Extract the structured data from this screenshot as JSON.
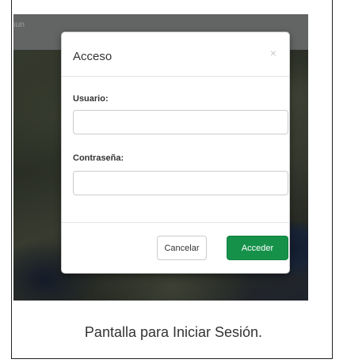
{
  "topbar": {
    "text": "ıun"
  },
  "modal": {
    "title": "Acceso",
    "close_symbol": "×",
    "username_label": "Usuario:",
    "username_value": "",
    "password_label": "Contraseña:",
    "password_value": "",
    "cancel_label": "Cancelar",
    "submit_label": "Acceder"
  },
  "caption": "Pantalla para Iniciar Sesión.",
  "colors": {
    "submit_button": "#16914a",
    "modal_background": "#ffffff",
    "backdrop_dim": "rgba(0,0,0,0.28)"
  }
}
